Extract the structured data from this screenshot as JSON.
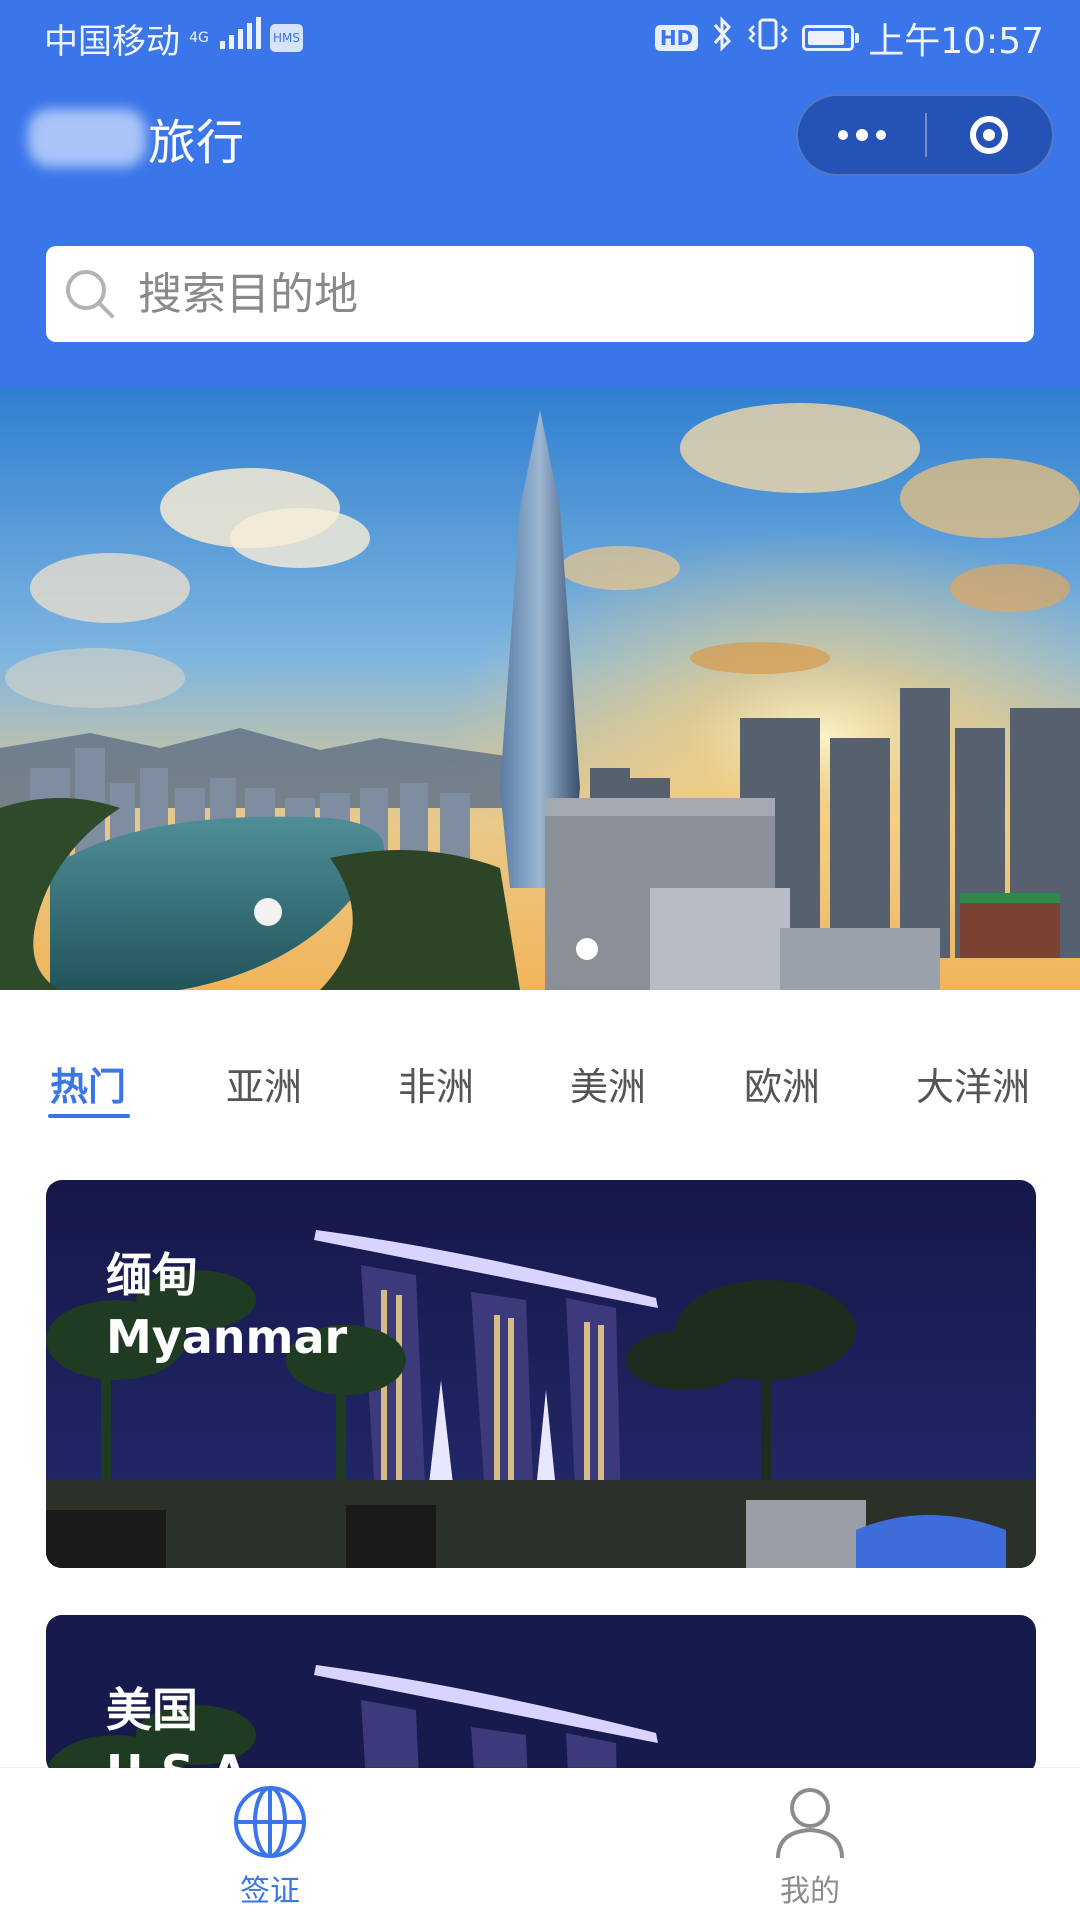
{
  "status_bar": {
    "carrier": "中国移动",
    "network": "4G",
    "hd": "HD",
    "time": "上午10:57"
  },
  "nav": {
    "title": "旅行"
  },
  "search": {
    "placeholder": "搜索目的地"
  },
  "banner": {
    "slide_count": 1,
    "active_index": 0
  },
  "tabs": [
    {
      "label": "热门",
      "active": true
    },
    {
      "label": "亚洲",
      "active": false
    },
    {
      "label": "非洲",
      "active": false
    },
    {
      "label": "美洲",
      "active": false
    },
    {
      "label": "欧洲",
      "active": false
    },
    {
      "label": "大洋洲",
      "active": false
    }
  ],
  "cards": [
    {
      "name_cn": "缅甸",
      "name_en": "Myanmar"
    },
    {
      "name_cn": "美国",
      "name_en": "U.S.A"
    }
  ],
  "tabbar": [
    {
      "label": "签证",
      "icon": "globe-icon",
      "active": true
    },
    {
      "label": "我的",
      "icon": "user-icon",
      "active": false
    }
  ],
  "colors": {
    "primary": "#3a76ea",
    "inactive": "#8c8c8c"
  }
}
